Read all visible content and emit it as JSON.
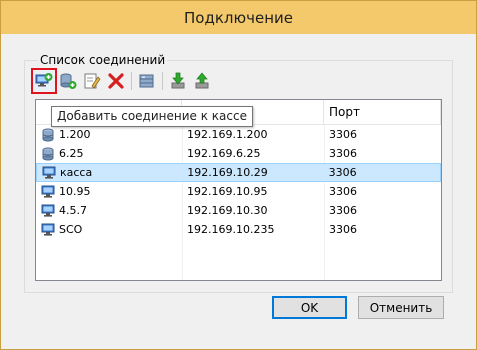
{
  "window": {
    "title": "Подключение"
  },
  "group": {
    "label": "Список соединений"
  },
  "toolbar": {
    "buttons": [
      {
        "name": "add-cash-connection",
        "icon": "monitor-add-icon"
      },
      {
        "name": "add-db-connection",
        "icon": "database-add-icon"
      },
      {
        "name": "edit-connection",
        "icon": "edit-icon"
      },
      {
        "name": "delete-connection",
        "icon": "delete-icon"
      },
      {
        "name": "database",
        "icon": "database-icon"
      },
      {
        "name": "import",
        "icon": "import-icon"
      },
      {
        "name": "export",
        "icon": "export-icon"
      }
    ],
    "tooltip": "Добавить соединение к кассе"
  },
  "list": {
    "columns": {
      "name": "",
      "address": "",
      "port": "Порт"
    },
    "rows": [
      {
        "name": "1.200",
        "address": "192.169.1.200",
        "port": "3306",
        "icon": "database-icon",
        "selected": false
      },
      {
        "name": "6.25",
        "address": "192.169.6.25",
        "port": "3306",
        "icon": "database-icon",
        "selected": false
      },
      {
        "name": "касса",
        "address": "192.169.10.29",
        "port": "3306",
        "icon": "monitor-icon",
        "selected": true
      },
      {
        "name": "10.95",
        "address": "192.169.10.95",
        "port": "3306",
        "icon": "monitor-icon",
        "selected": false
      },
      {
        "name": "4.5.7",
        "address": "192.169.10.30",
        "port": "3306",
        "icon": "monitor-icon",
        "selected": false
      },
      {
        "name": "SCO",
        "address": "192.169.10.235",
        "port": "3306",
        "icon": "monitor-icon",
        "selected": false
      }
    ]
  },
  "buttons": {
    "ok": "OK",
    "cancel": "Отменить"
  },
  "colors": {
    "titlebar": "#f3c96b",
    "selection": "#cce8ff",
    "highlight": "#e0141e"
  }
}
